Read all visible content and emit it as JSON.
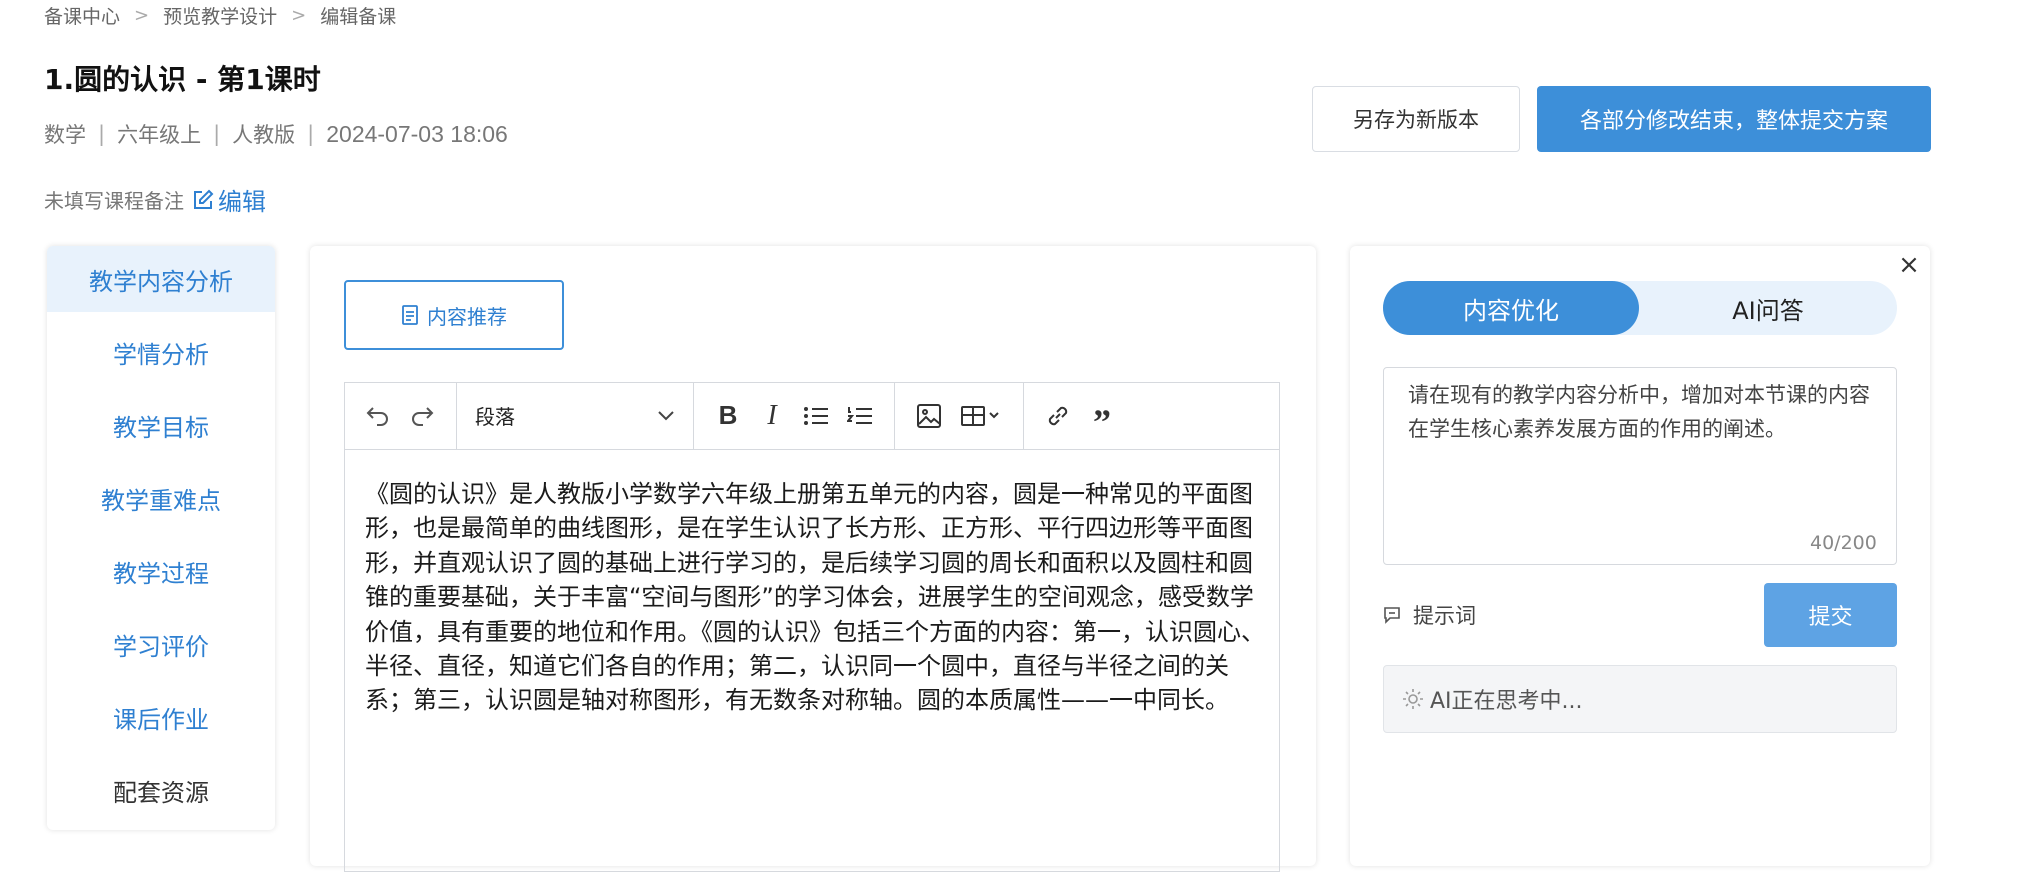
{
  "breadcrumb": [
    "备课中心",
    "预览教学设计",
    "编辑备课"
  ],
  "lesson": {
    "title": "1.圆的认识 - 第1课时",
    "subject": "数学",
    "grade": "六年级上",
    "edition": "人教版",
    "datetime": "2024-07-03 18:06",
    "note_placeholder": "未填写课程备注",
    "edit_label": "编辑"
  },
  "actions": {
    "save_new_version": "另存为新版本",
    "submit_all": "各部分修改结束，整体提交方案"
  },
  "sidebar": {
    "items": [
      {
        "label": "教学内容分析",
        "active": true
      },
      {
        "label": "学情分析"
      },
      {
        "label": "教学目标"
      },
      {
        "label": "教学重难点"
      },
      {
        "label": "教学过程"
      },
      {
        "label": "学习评价"
      },
      {
        "label": "课后作业"
      },
      {
        "label": "配套资源"
      }
    ]
  },
  "editor": {
    "recommend_label": "内容推荐",
    "block_format": "段落",
    "content": "《圆的认识》是人教版小学数学六年级上册第五单元的内容，圆是一种常见的平面图形，也是最简单的曲线图形，是在学生认识了长方形、正方形、平行四边形等平面图形，并直观认识了圆的基础上进行学习的，是后续学习圆的周长和面积以及圆柱和圆锥的重要基础，关于丰富“空间与图形”的学习体会，进展学生的空间观念，感受数学价值，具有重要的地位和作用。《圆的认识》包括三个方面的内容：第一，认识圆心、半径、直径，知道它们各自的作用；第二，认识同一个圆中，直径与半径之间的关系；第三，认识圆是轴对称图形，有无数条对称轴。圆的本质属性——一中同长。"
  },
  "ai_panel": {
    "tabs": [
      "内容优化",
      "AI问答"
    ],
    "active_tab": "内容优化",
    "prompt_text": "请在现有的教学内容分析中，增加对本节课的内容在学生核心素养发展方面的作用的阐述。",
    "char_count": "40/200",
    "hint_label": "提示词",
    "submit_label": "提交",
    "status": "AI正在思考中..."
  },
  "colors": {
    "primary": "#3d8fd9",
    "primary_light": "#e8f2fc",
    "submit_disabled": "#5ea3e4"
  }
}
